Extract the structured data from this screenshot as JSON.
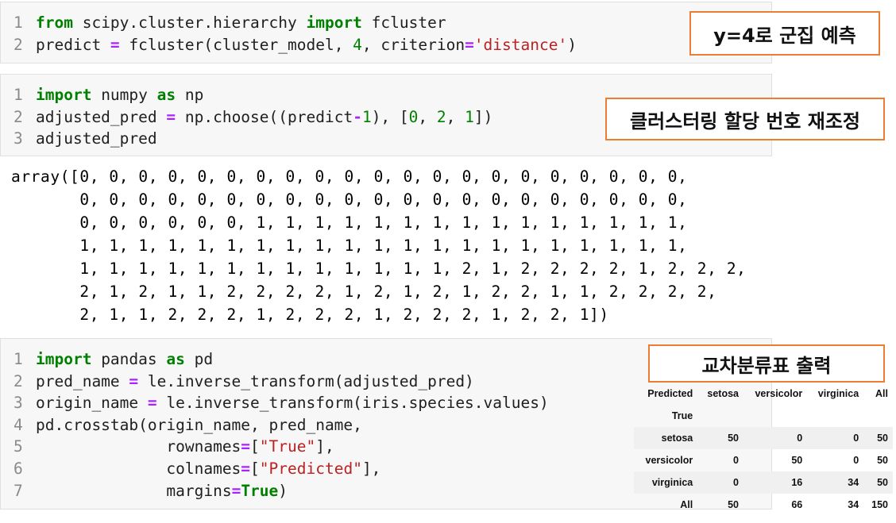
{
  "cell1": {
    "line_numbers": [
      "1",
      "2"
    ],
    "l1": {
      "kw1": "from",
      "mod": " scipy.cluster.hierarchy ",
      "kw2": "import",
      "name": " fcluster"
    },
    "l2": {
      "a": "predict ",
      "op": "=",
      "b": " fcluster(cluster_model, ",
      "num": "4",
      "c": ", criterion",
      "op2": "=",
      "str": "'distance'",
      "d": ")"
    }
  },
  "callout1": "y=4로 군집 예측",
  "cell2": {
    "line_numbers": [
      "1",
      "2",
      "3"
    ],
    "l1": {
      "kw1": "import",
      "mod": " numpy ",
      "kw2": "as",
      "name": " np"
    },
    "l2": {
      "a": "adjusted_pred ",
      "op": "=",
      "b": " np.choose((predict",
      "op2": "-",
      "n1": "1",
      "c": "), [",
      "n2": "0",
      "d": ", ",
      "n3": "2",
      "e": ", ",
      "n4": "1",
      "f": "])"
    },
    "l3": "adjusted_pred"
  },
  "callout2": "클러스터링 할당 번호 재조정",
  "output_lines": [
    "array([0, 0, 0, 0, 0, 0, 0, 0, 0, 0, 0, 0, 0, 0, 0, 0, 0, 0, 0, 0, 0,",
    "       0, 0, 0, 0, 0, 0, 0, 0, 0, 0, 0, 0, 0, 0, 0, 0, 0, 0, 0, 0, 0,",
    "       0, 0, 0, 0, 0, 0, 1, 1, 1, 1, 1, 1, 1, 1, 1, 1, 1, 1, 1, 1, 1,",
    "       1, 1, 1, 1, 1, 1, 1, 1, 1, 1, 1, 1, 1, 1, 1, 1, 1, 1, 1, 1, 1,",
    "       1, 1, 1, 1, 1, 1, 1, 1, 1, 1, 1, 1, 1, 2, 1, 2, 2, 2, 2, 1, 2, 2, 2,",
    "       2, 1, 2, 1, 1, 2, 2, 2, 2, 1, 2, 1, 2, 1, 2, 2, 1, 1, 2, 2, 2, 2,",
    "       2, 1, 1, 2, 2, 2, 1, 2, 2, 2, 1, 2, 2, 2, 1, 2, 2, 1])"
  ],
  "cell3": {
    "line_numbers": [
      "1",
      "2",
      "3",
      "4",
      "5",
      "6",
      "7"
    ],
    "l1": {
      "kw1": "import",
      "mod": " pandas ",
      "kw2": "as",
      "name": " pd"
    },
    "l2": {
      "a": "pred_name ",
      "op": "=",
      "b": " le.inverse_transform(adjusted_pred)"
    },
    "l3": {
      "a": "origin_name ",
      "op": "=",
      "b": " le.inverse_transform(iris.species.values)"
    },
    "l4": "pd.crosstab(origin_name, pred_name,",
    "l5": {
      "indent": "              ",
      "a": "rownames",
      "op": "=",
      "b": "[",
      "str": "\"True\"",
      "c": "],"
    },
    "l6": {
      "indent": "              ",
      "a": "colnames",
      "op": "=",
      "b": "[",
      "str": "\"Predicted\"",
      "c": "],"
    },
    "l7": {
      "indent": "              ",
      "a": "margins",
      "op": "=",
      "true": "True",
      "c": ")"
    }
  },
  "callout3": "교차분류표 출력",
  "crosstab": {
    "col_axis": "Predicted",
    "row_axis": "True",
    "columns": [
      "setosa",
      "versicolor",
      "virginica",
      "All"
    ],
    "rows": [
      {
        "label": "setosa",
        "values": [
          "50",
          "0",
          "0",
          "50"
        ]
      },
      {
        "label": "versicolor",
        "values": [
          "0",
          "50",
          "0",
          "50"
        ]
      },
      {
        "label": "virginica",
        "values": [
          "0",
          "16",
          "34",
          "50"
        ]
      },
      {
        "label": "All",
        "values": [
          "50",
          "66",
          "34",
          "150"
        ]
      }
    ]
  }
}
